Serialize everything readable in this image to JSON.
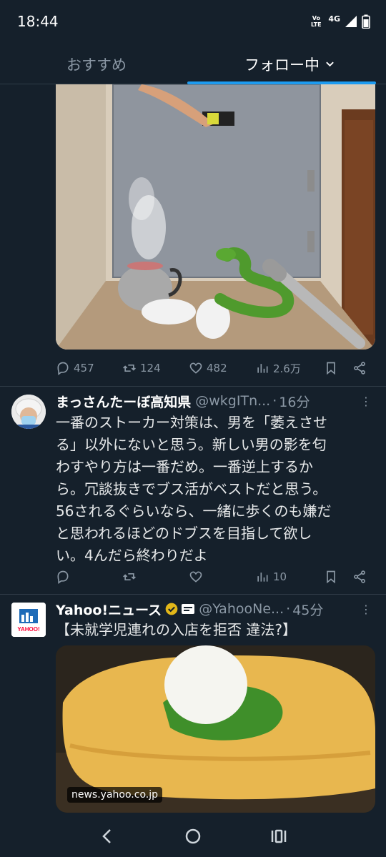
{
  "status_bar": {
    "time": "18:44",
    "volte": "Vo LTE",
    "network": "4G"
  },
  "tabs": [
    {
      "label": "おすすめ"
    },
    {
      "label": "フォロー中"
    }
  ],
  "colors": {
    "background": "#15202b",
    "accent": "#1d9bf0",
    "muted": "#8b98a5",
    "verified_gold": "#e2b719"
  },
  "post1": {
    "image_alt_icons": [
      "kettle",
      "sneakers",
      "snake",
      "baseball-bat",
      "door"
    ],
    "replies": "457",
    "retweets": "124",
    "likes": "482",
    "views": "2.6万"
  },
  "post2": {
    "display_name": "まっさんたーぼ高知県",
    "handle": "@wkgITn...",
    "time_ago": "16分",
    "text_lines": [
      "一番のストーカー対策は、男を「萎えさせ",
      "る」以外にないと思う。新しい男の影を匂",
      "わすやり方は一番だめ。一番逆上するか",
      "ら。冗談抜きでブス活がベストだと思う。",
      "56されるぐらいなら、一緒に歩くのも嫌だ",
      "と思われるほどのドブスを目指して欲し",
      "い。4んだら終わりだよ"
    ],
    "views": "10"
  },
  "post3": {
    "display_name": "Yahoo!ニュース",
    "handle": "@YahooNe...",
    "time_ago": "45分",
    "text": "【未就学児連れの入店を拒否 違法?】",
    "link_domain": "news.yahoo.co.jp",
    "avatar_text": "YAHOO!"
  }
}
